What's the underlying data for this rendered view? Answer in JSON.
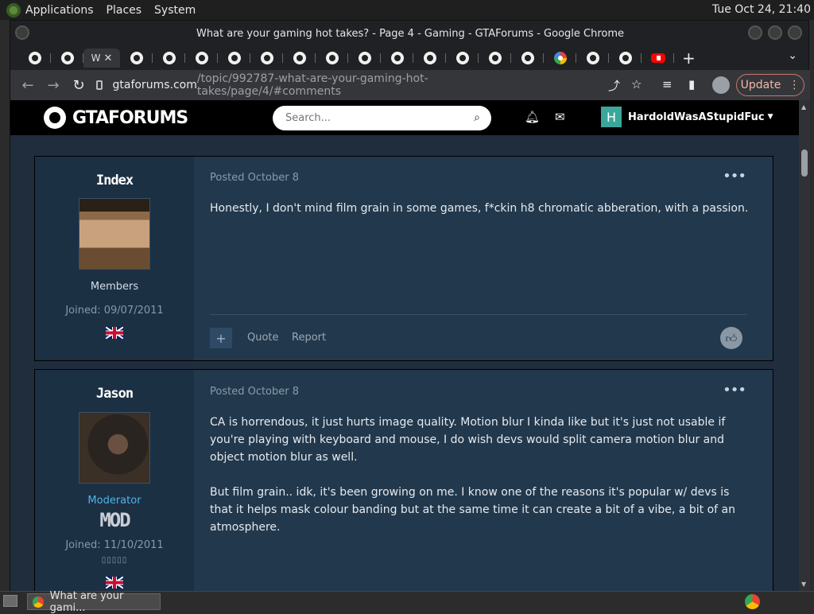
{
  "system_panel": {
    "menus": [
      "Applications",
      "Places",
      "System"
    ],
    "clock": "Tue Oct 24, 21:40"
  },
  "window": {
    "title": "What are your gaming hot takes? - Page 4 - Gaming - GTAForums - Google Chrome"
  },
  "tabs": {
    "active_label": "W",
    "new_tab": "+",
    "search_tabs": "⌄"
  },
  "toolbar": {
    "url_host": "gtaforums.com",
    "url_path": "/topic/992787-what-are-your-gaming-hot-takes/page/4/#comments",
    "update_label": "Update"
  },
  "site": {
    "logo_text": "GTAFORUMS",
    "search_placeholder": "Search...",
    "username": "HardoldWasAStupidFuc",
    "user_initial": "H"
  },
  "posts": [
    {
      "author": "Index",
      "group": "Members",
      "joined": "Joined: 09/07/2011",
      "posted": "Posted October 8",
      "paragraphs": [
        "Honestly, I don't mind film grain in some games, f*ckin h8 chromatic abberation, with a passion."
      ],
      "actions": {
        "quote": "Quote",
        "report": "Report"
      }
    },
    {
      "author": "Jason",
      "group": "Moderator",
      "badge": "MOD",
      "joined": "Joined: 11/10/2011",
      "posted": "Posted October 8",
      "paragraphs": [
        "CA is horrendous, it just hurts image quality. Motion blur I kinda like but it's just not usable if you're playing with keyboard and mouse, I do wish devs would split camera motion blur and object motion blur as well.",
        "But film grain.. idk, it's been growing on me. I know one of the reasons it's popular w/ devs is that it helps mask colour banding but at the same time it can create a bit of a vibe, a bit of an atmosphere."
      ]
    }
  ],
  "taskbar": {
    "item_label": "What are your gami..."
  },
  "colors": {
    "post_bg": "#22384c",
    "author_bg": "#1c3044",
    "moderator": "#4fb3e8"
  }
}
